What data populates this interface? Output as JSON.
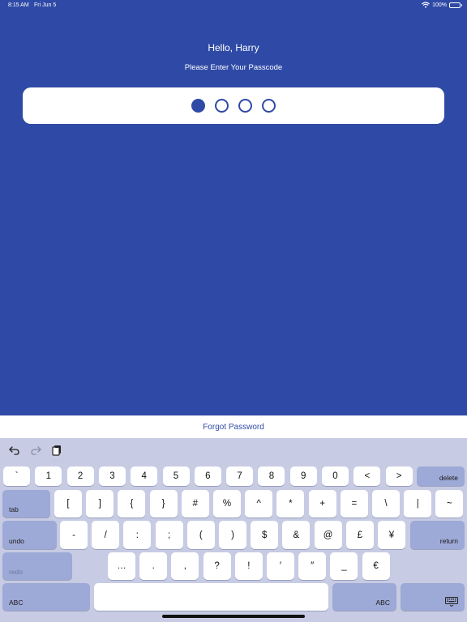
{
  "status_bar": {
    "time": "8:15 AM",
    "date": "Fri Jun 5",
    "battery": "100%"
  },
  "greeting": "Hello, Harry",
  "prompt": "Please Enter Your Passcode",
  "passcode": {
    "length": 4,
    "entered": 1
  },
  "forgot_password": "Forgot Password",
  "colors": {
    "accent": "#2f4aa6",
    "keyboard_bg": "#c7cbe3",
    "function_key": "#9da9d6"
  },
  "keyboard": {
    "toolbar": [
      "undo-icon",
      "redo-icon",
      "paste-icon"
    ],
    "row1": [
      "`",
      "1",
      "2",
      "3",
      "4",
      "5",
      "6",
      "7",
      "8",
      "9",
      "0",
      "<",
      ">"
    ],
    "row1_delete": "delete",
    "row2_tab": "tab",
    "row2": [
      "[",
      "]",
      "{",
      "}",
      "#",
      "%",
      "^",
      "*",
      "+",
      "=",
      "\\",
      "|",
      "~"
    ],
    "row3_undo": "undo",
    "row3": [
      "-",
      "/",
      ":",
      ";",
      "(",
      ")",
      "$",
      "&",
      "@",
      "£",
      "¥"
    ],
    "row3_return": "return",
    "row4_redo": "redo",
    "row4": [
      "…",
      ".",
      ",",
      "?",
      "!",
      "′",
      "″",
      "_",
      "€"
    ],
    "row5_abc_left": "ABC",
    "row5_abc_right": "ABC"
  }
}
